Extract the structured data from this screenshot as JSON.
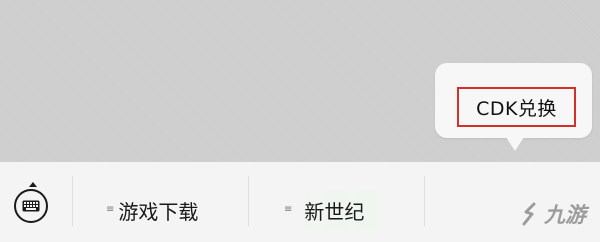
{
  "popup": {
    "cdk_label": "CDK兑换"
  },
  "menu": {
    "items": [
      {
        "label": "游戏下载"
      },
      {
        "label": "新世纪"
      }
    ]
  },
  "watermark": {
    "text": "九游"
  },
  "icons": {
    "keyboard": "keyboard-icon",
    "menu_lines": "menu-lines-icon"
  }
}
